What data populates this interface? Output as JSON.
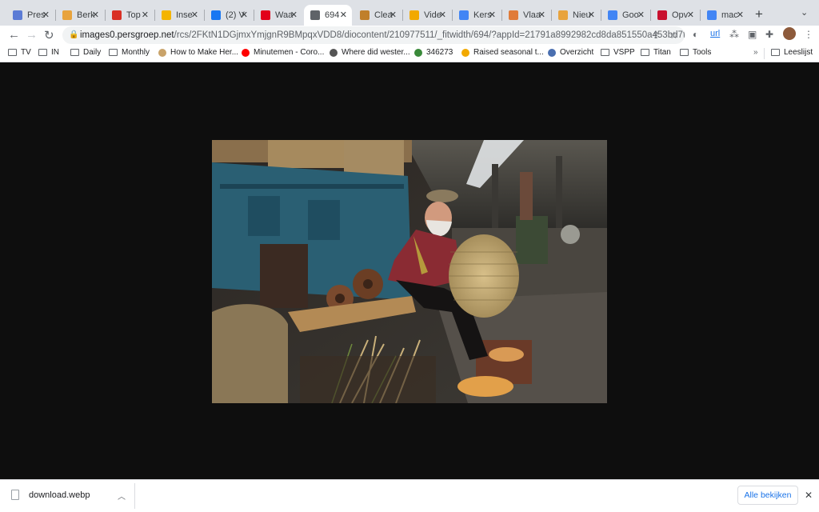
{
  "tabs": [
    {
      "label": "Pres",
      "icon": "globe-icon",
      "color": "#5b7bd5"
    },
    {
      "label": "Berk",
      "icon": "in-logo-icon",
      "color": "#e8a33d"
    },
    {
      "label": "Top",
      "icon": "gmail-icon",
      "color": "#d93025"
    },
    {
      "label": "Inse",
      "icon": "doc-icon",
      "color": "#f4b400"
    },
    {
      "label": "(2) V",
      "icon": "facebook-icon",
      "color": "#1877f2"
    },
    {
      "label": "Waa",
      "icon": "ad-logo-icon",
      "color": "#e2001a"
    },
    {
      "label": "694",
      "icon": "globe-icon",
      "color": "#5f6368",
      "active": true
    },
    {
      "label": "Clea",
      "icon": "flask-icon",
      "color": "#c07f2a"
    },
    {
      "label": "Vide",
      "icon": "smiley-icon",
      "color": "#f2a900"
    },
    {
      "label": "Kers",
      "icon": "docs-icon",
      "color": "#4285f4"
    },
    {
      "label": "Vlaa",
      "icon": "wolf-icon",
      "color": "#e07b39"
    },
    {
      "label": "Nieu",
      "icon": "in-logo-icon",
      "color": "#e8a33d"
    },
    {
      "label": "Goo",
      "icon": "calendar-icon",
      "color": "#4285f4"
    },
    {
      "label": "Opv",
      "icon": "gva-logo-icon",
      "color": "#c8102e"
    },
    {
      "label": "mac",
      "icon": "google-icon",
      "color": "#4285f4"
    }
  ],
  "toolbar": {
    "url_host": "images0.persgroep.net",
    "url_path": "/rcs/2FKtN1DGjmxYmjgnR9BMpqxVDD8/diocontent/210977511/_fitwidth/694/?appId=21791a8992982cd8da851550a453bd7f&q..."
  },
  "bookmarks": [
    {
      "label": "TV",
      "icon": "folder-icon"
    },
    {
      "label": "IN",
      "icon": "folder-icon"
    },
    {
      "label": "Daily",
      "icon": "folder-icon"
    },
    {
      "label": "Monthly",
      "icon": "folder-icon"
    },
    {
      "label": "How to Make Her...",
      "icon": "leaf-icon"
    },
    {
      "label": "Minutemen - Coro...",
      "icon": "youtube-icon"
    },
    {
      "label": "Where did wester...",
      "icon": "bird-icon"
    },
    {
      "label": "346273",
      "icon": "person-icon"
    },
    {
      "label": "Raised seasonal t...",
      "icon": "nbv-logo-icon"
    },
    {
      "label": "Overzicht",
      "icon": "swirl-icon"
    },
    {
      "label": "VSPP",
      "icon": "folder-icon"
    },
    {
      "label": "Titan",
      "icon": "folder-icon"
    },
    {
      "label": "Tools",
      "icon": "folder-icon"
    }
  ],
  "bookmarks_more": "»",
  "reading_list": "Leeslijst",
  "download": {
    "filename": "download.webp",
    "show_all": "Alle bekijken"
  }
}
